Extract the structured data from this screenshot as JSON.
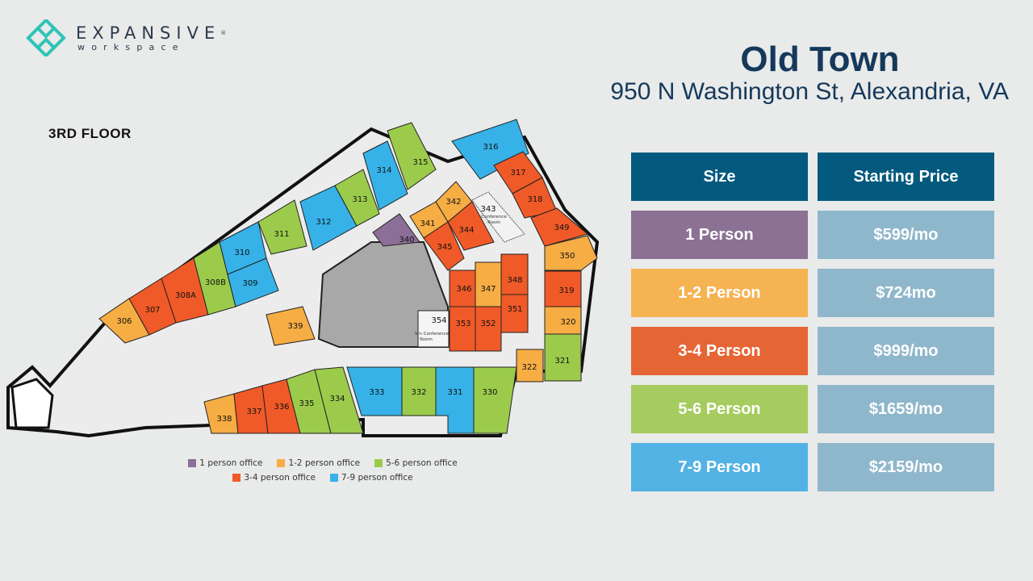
{
  "brand": {
    "name": "EXPANSIVE",
    "registered": "®",
    "sub": "workspace",
    "color": "#2ec4b6"
  },
  "header": {
    "title": "Old Town",
    "address": "950 N Washington St, Alexandria, VA"
  },
  "floor": {
    "label": "3RD FLOOR"
  },
  "colors": {
    "one": "#8b6f96",
    "one_two": "#f6ad44",
    "three_four": "#f05a28",
    "five_six": "#9ccb4c",
    "seven_nine": "#36b2e8",
    "header_bg": "#035a7e",
    "price_bg": "#8fb7cb",
    "core": "#a8a8a8"
  },
  "rooms": {
    "r306": "306",
    "r307": "307",
    "r308a": "308A",
    "r308b": "308B",
    "r309": "309",
    "r310": "310",
    "r311": "311",
    "r312": "312",
    "r313": "313",
    "r314": "314",
    "r315": "315",
    "r316": "316",
    "r317": "317",
    "r318": "318",
    "r349": "349",
    "r350": "350",
    "r319": "319",
    "r320": "320",
    "r321": "321",
    "r322": "322",
    "r330": "330",
    "r331": "331",
    "r332": "332",
    "r333": "333",
    "r334": "334",
    "r335": "335",
    "r336": "336",
    "r337": "337",
    "r338": "338",
    "r339": "339",
    "r340": "340",
    "r341": "341",
    "r342": "342",
    "r343": "343",
    "r344": "344",
    "r345": "345",
    "r346": "346",
    "r347": "347",
    "r348": "348",
    "r351": "351",
    "r352": "352",
    "r353": "353",
    "r354": "354"
  },
  "room_notes": {
    "conf": "Conference",
    "conf2": "Room",
    "sm_conf": "Sm Conference",
    "sm_conf2": "Room"
  },
  "legend": [
    {
      "label": "1 person office",
      "color": "#8b6f96"
    },
    {
      "label": "1-2 person office",
      "color": "#f6ad44"
    },
    {
      "label": "5-6 person office",
      "color": "#9ccb4c"
    },
    {
      "label": "3-4 person office",
      "color": "#f05a28"
    },
    {
      "label": "7-9 person office",
      "color": "#36b2e8"
    }
  ],
  "pricing": {
    "headers": {
      "size": "Size",
      "price": "Starting Price"
    },
    "rows": [
      {
        "size": "1 Person",
        "price": "$599/mo",
        "color": "#8b7194"
      },
      {
        "size": "1-2 Person",
        "price": "$724mo",
        "color": "#f6b352"
      },
      {
        "size": "3-4 Person",
        "price": "$999/mo",
        "color": "#e66535"
      },
      {
        "size": "5-6 Person",
        "price": "$1659/mo",
        "color": "#a6cc60"
      },
      {
        "size": "7-9 Person",
        "price": "$2159/mo",
        "color": "#52b2e4"
      }
    ]
  }
}
